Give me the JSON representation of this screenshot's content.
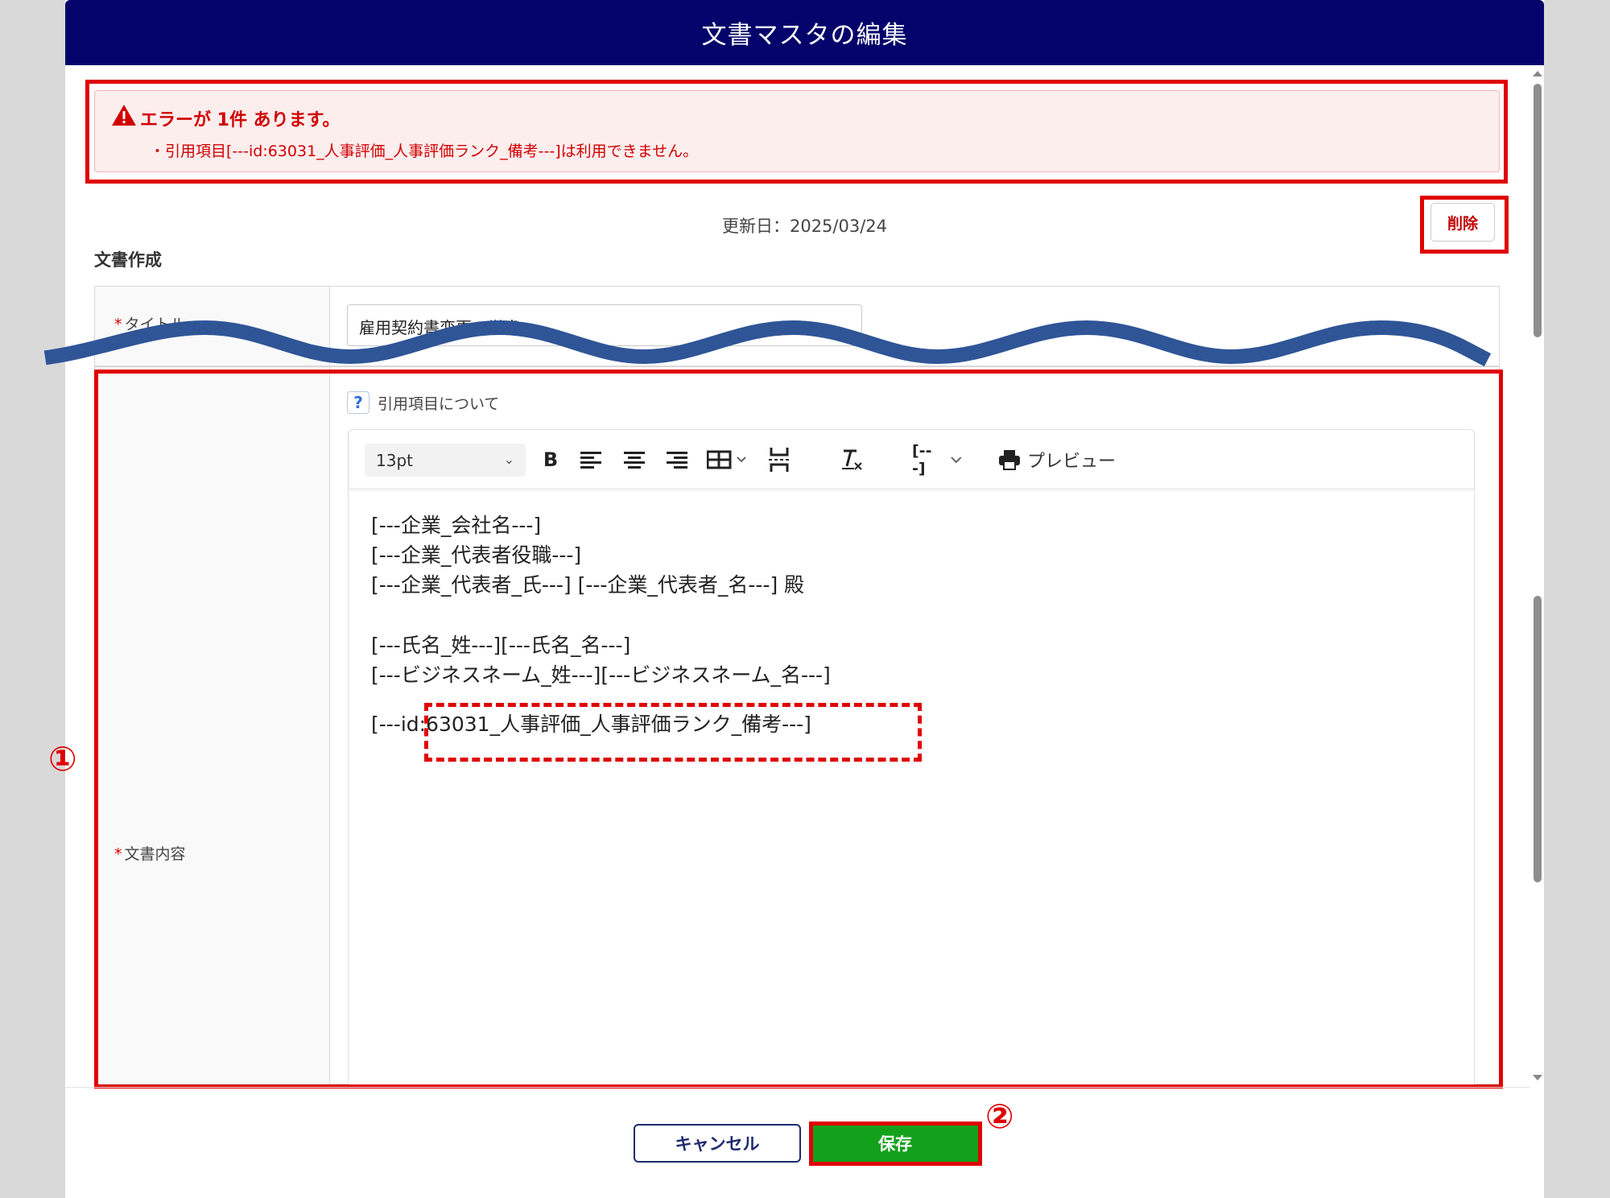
{
  "dialog": {
    "title": "文書マスタの編集"
  },
  "error": {
    "title": "エラーが 1件 あります。",
    "message": "・引用項目[---id:63031_人事評価_人事評価ランク_備考---]は利用できません。"
  },
  "meta": {
    "updated": "更新日：2025/03/24"
  },
  "actions": {
    "delete_label": "削除",
    "cancel_label": "キャンセル",
    "save_label": "保存"
  },
  "section": {
    "title": "文書作成"
  },
  "fields": {
    "title": {
      "label": "タイトル",
      "required_mark": "*",
      "value": "雇用契約書変更の覚書"
    },
    "content": {
      "label": "文書内容",
      "required_mark": "*"
    }
  },
  "help": {
    "label": "引用項目について",
    "icon": "question-icon"
  },
  "toolbar": {
    "font_size": "13pt",
    "bold": "B",
    "merge_field": "[---]",
    "preview_label": "プレビュー"
  },
  "editor": {
    "lines": [
      "[---企業_会社名---]",
      "[---企業_代表者役職---]",
      "[---企業_代表者_氏---] [---企業_代表者_名---] 殿",
      "[---氏名_姓---][---氏名_名---]",
      "[---ビジネスネーム_姓---][---ビジネスネーム_名---]",
      "[---id:63031_人事評価_人事評価ランク_備考---]"
    ]
  },
  "annotations": {
    "marker1": "①",
    "marker2": "②"
  },
  "colors": {
    "header": "#03036b",
    "error": "#d10000",
    "annotation": "#e00000",
    "save": "#13a11c"
  }
}
